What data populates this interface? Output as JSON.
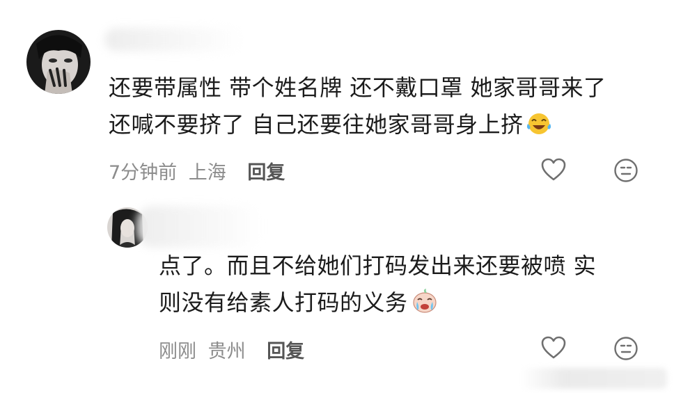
{
  "comments": [
    {
      "text_line1": "还要带属性 带个姓名牌 还不戴口罩 她家哥哥来了",
      "text_line2": "还喊不要挤了 自己还要往她家哥哥身上挤",
      "emoji": "tears-of-joy-emoji",
      "time": "7分钟前",
      "location": "上海",
      "reply_label": "回复"
    },
    {
      "text_line1": "点了。而且不给她们打码发出来还要被喷 实",
      "text_line2": "则没有给素人打码的义务",
      "emoji": "crying-emoji",
      "time": "刚刚",
      "location": "贵州",
      "reply_label": "回复"
    }
  ],
  "icons": {
    "like": "heart-outline-icon",
    "dislike": "neutral-face-icon"
  },
  "colors": {
    "meta_text": "#8c8c8c",
    "reply_text": "#555555",
    "icon_stroke": "#6f6f6f"
  }
}
